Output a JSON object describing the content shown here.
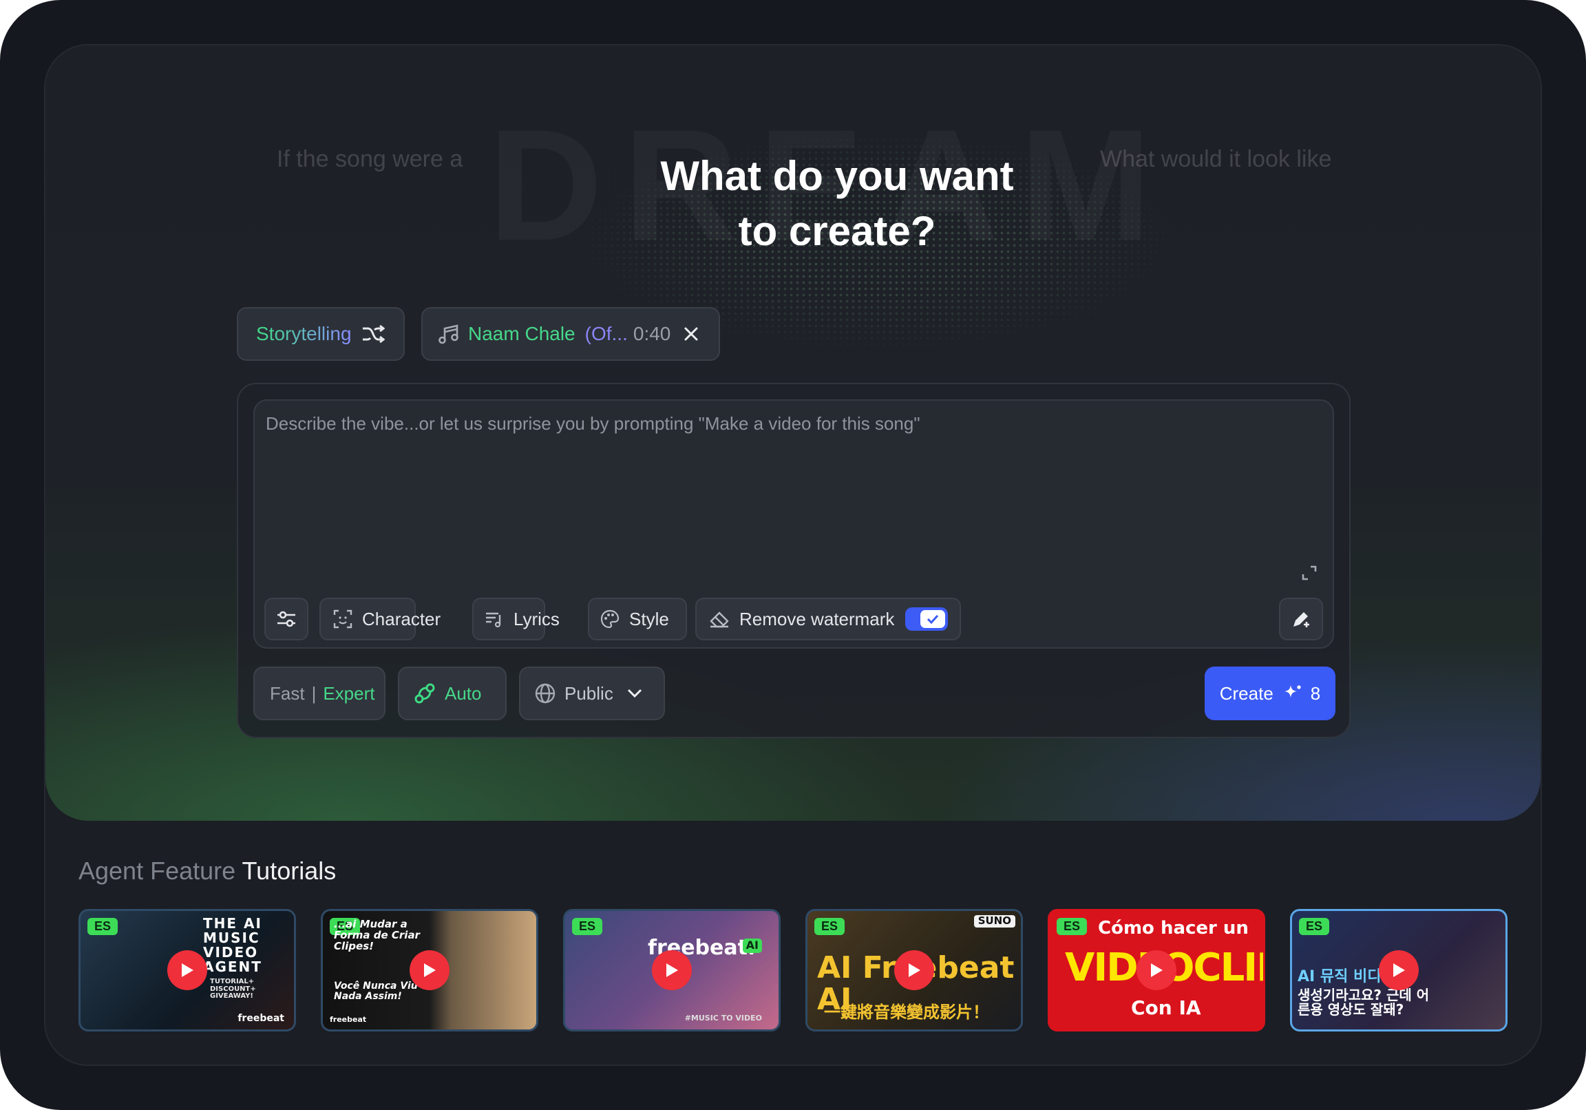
{
  "hero": {
    "background_word": "DREAM",
    "ghost_left": "If the song were a",
    "ghost_right": "What would it look like",
    "title_line1": "What do you want",
    "title_line2": "to create?"
  },
  "chips": {
    "mode_label": "Storytelling",
    "song_name": "Naam Chale",
    "song_suffix": "(Of...",
    "song_duration": "0:40"
  },
  "composer": {
    "placeholder": "Describe the vibe...or let us surprise you by prompting \"Make a video for this song\"",
    "tools": {
      "character": "Character",
      "lyrics": "Lyrics",
      "style": "Style",
      "remove_watermark": "Remove watermark",
      "remove_watermark_checked": true
    },
    "speed": {
      "fast": "Fast",
      "separator": "|",
      "expert": "Expert"
    },
    "auto_label": "Auto",
    "visibility": "Public",
    "create_label": "Create",
    "create_cost": "8"
  },
  "tutorials": {
    "title_muted": "Agent Feature",
    "title_bold": "Tutorials",
    "items": [
      {
        "badge": "ES",
        "caption": "THE AI MUSIC VIDEO AGENT",
        "sub": "TUTORIAL+ DISCOUNT+ GIVEAWAY!",
        "brand": "freebeat"
      },
      {
        "badge": "ES",
        "caption": "...ai Mudar a Forma de Criar Clipes!",
        "sub": "Você Nunca Viu Nada Assim!",
        "brand": "freebeat"
      },
      {
        "badge": "ES",
        "caption": "freebeat.",
        "sub": "#MUSIC TO VIDEO",
        "brand": "AI"
      },
      {
        "badge": "ES",
        "caption": "AI Freebeat AI",
        "sub": "一鍵將音樂變成影片！",
        "brand": "SUNO"
      },
      {
        "badge": "ES",
        "caption": "Cómo hacer un",
        "sub": "VIDEOCLIP",
        "brand": "Con IA"
      },
      {
        "badge": "ES",
        "caption": "AI 뮤직 비디오",
        "sub": "생성기라고요? 근데 어른용 영상도 잘돼?",
        "brand": ""
      }
    ]
  }
}
